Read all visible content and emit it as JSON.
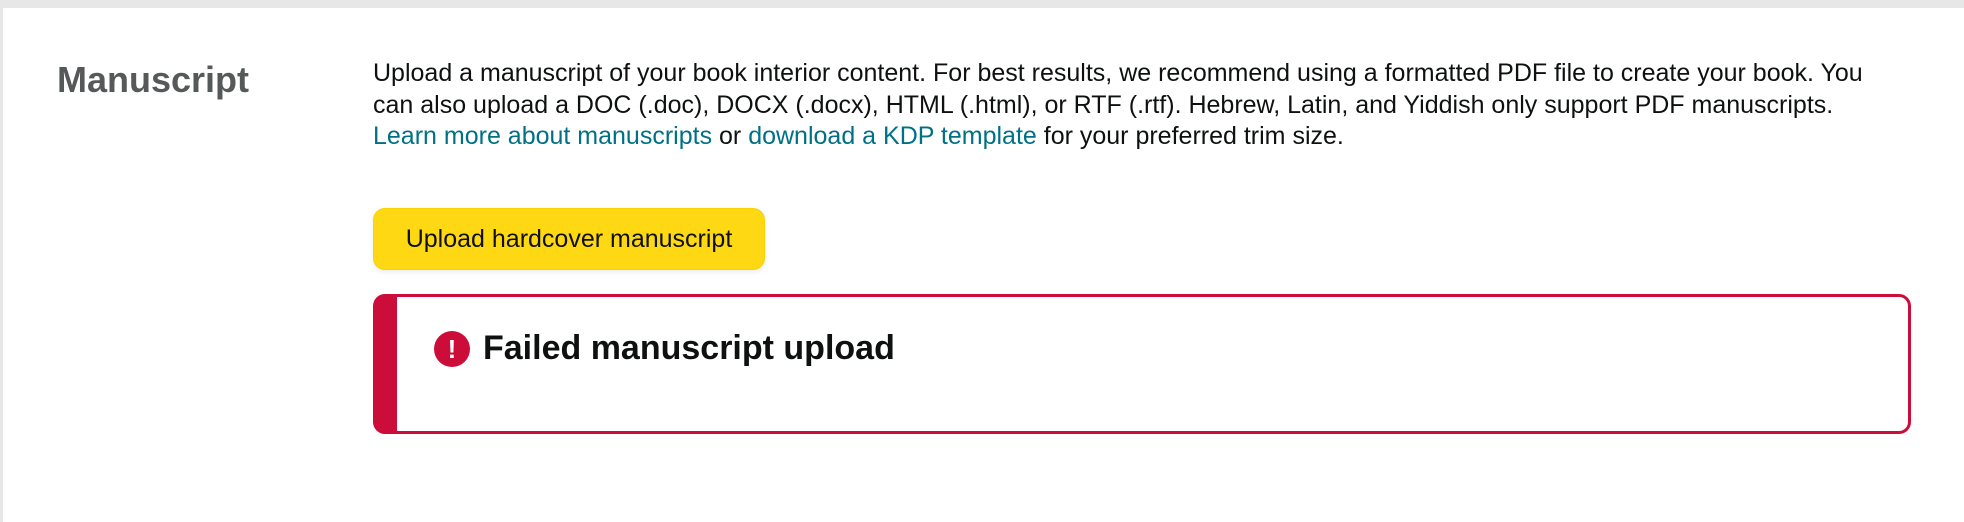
{
  "section": {
    "title": "Manuscript"
  },
  "description": {
    "text_before": "Upload a manuscript of your book interior content. For best results, we recommend using a formatted PDF file to create your book. You can also upload a DOC (.doc), DOCX (.docx), HTML (.html), or RTF (.rtf). Hebrew, Latin, and Yiddish only support PDF manuscripts. ",
    "link_learn_more": "Learn more about manuscripts",
    "text_middle": " or ",
    "link_template": "download a KDP template",
    "text_after": " for your preferred trim size."
  },
  "upload_button": {
    "label": "Upload hardcover manuscript"
  },
  "alert": {
    "icon": "error-exclamation-icon",
    "icon_glyph": "!",
    "heading": "Failed manuscript upload"
  },
  "colors": {
    "link": "#007185",
    "button": "#ffd814",
    "error": "#cc0c39",
    "title_gray": "#565959"
  }
}
